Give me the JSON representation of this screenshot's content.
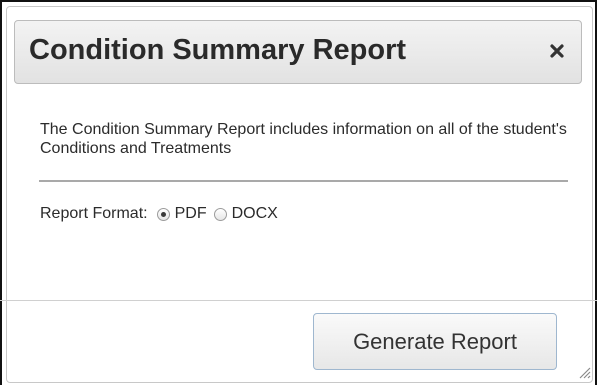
{
  "dialog": {
    "title": "Condition Summary Report",
    "close_icon": "close-icon",
    "description": "The Condition Summary Report includes information on all of the student's Conditions and Treatments",
    "report_format": {
      "label": "Report Format:",
      "options": [
        {
          "label": "PDF",
          "selected": true
        },
        {
          "label": "DOCX",
          "selected": false
        }
      ]
    },
    "generate_button_label": "Generate Report",
    "resize_icon": "resize-grip-icon"
  }
}
